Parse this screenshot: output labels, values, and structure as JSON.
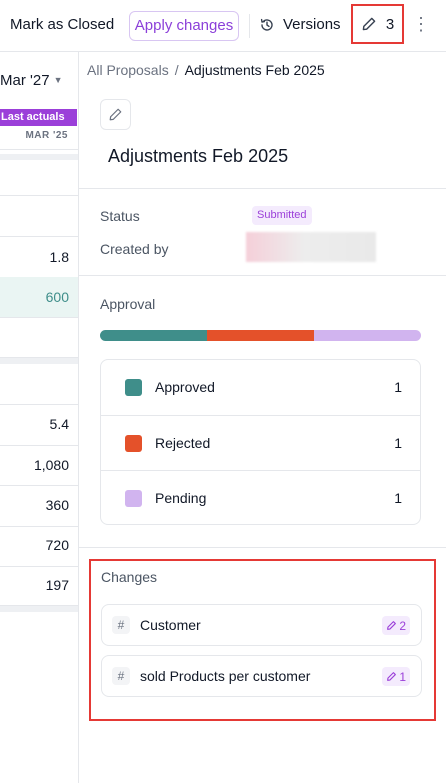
{
  "toolbar": {
    "mark_closed_label": "Mark as Closed",
    "apply_changes_label": "Apply changes",
    "versions_label": "Versions",
    "changes_count": "3",
    "more_icon": "vertical-dots-icon",
    "accent_color": "#8b3fd9"
  },
  "background_table": {
    "month_label": "Mar '27",
    "badge_label": "Last actuals",
    "sub_label": "MAR '25",
    "values": [
      "1.8",
      "600",
      "5.4",
      "1,080",
      "360",
      "720",
      "197"
    ]
  },
  "breadcrumb": {
    "root": "All Proposals",
    "separator": "/",
    "current": "Adjustments Feb 2025"
  },
  "proposal": {
    "title": "Adjustments Feb 2025",
    "status_label": "Status",
    "status_value": "Submitted",
    "created_by_label": "Created by"
  },
  "approval": {
    "heading": "Approval",
    "segments": [
      {
        "name": "Approved",
        "count": "1",
        "color": "#3f8e8a",
        "share": 0.3333
      },
      {
        "name": "Rejected",
        "count": "1",
        "color": "#e4512a",
        "share": 0.3333
      },
      {
        "name": "Pending",
        "count": "1",
        "color": "#d1b4ef",
        "share": 0.3334
      }
    ]
  },
  "changes": {
    "heading": "Changes",
    "items": [
      {
        "name": "Customer",
        "count": "2",
        "icon": "hash-icon"
      },
      {
        "name": "sold Products per customer",
        "count": "1",
        "icon": "hash-icon"
      }
    ]
  }
}
